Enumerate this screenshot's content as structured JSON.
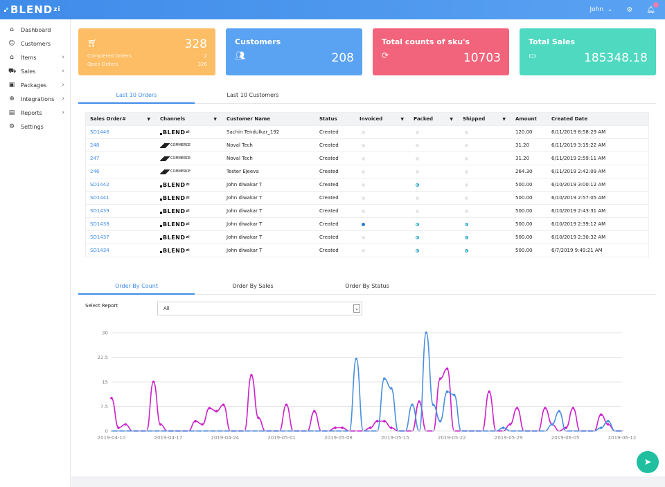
{
  "header": {
    "logo_text": "BLEND",
    "logo_suffix": "zi",
    "user": "John",
    "user_chevron": "⌄"
  },
  "sidebar": {
    "items": [
      {
        "label": "Dashboard",
        "icon": "home-icon",
        "chevron": false
      },
      {
        "label": "Customers",
        "icon": "user-icon",
        "chevron": false
      },
      {
        "label": "Items",
        "icon": "home-icon",
        "chevron": true
      },
      {
        "label": "Sales",
        "icon": "cart-icon",
        "chevron": true
      },
      {
        "label": "Packages",
        "icon": "package-icon",
        "chevron": true
      },
      {
        "label": "Integrations",
        "icon": "integration-icon",
        "chevron": true
      },
      {
        "label": "Reports",
        "icon": "report-icon",
        "chevron": true
      },
      {
        "label": "Settings",
        "icon": "gear-icon",
        "chevron": false
      }
    ]
  },
  "cards": {
    "orders": {
      "value": "328",
      "completed_label": "Completed Orders",
      "completed_value": "2",
      "open_label": "Open Orders",
      "open_value": "326"
    },
    "customers": {
      "title": "Customers",
      "value": "208"
    },
    "sku": {
      "title": "Total counts of sku's",
      "value": "10703"
    },
    "sales": {
      "title": "Total Sales",
      "value": "185348.18"
    }
  },
  "tabs_top": [
    "Last 10 Orders",
    "Last 10 Customers"
  ],
  "table": {
    "headers": [
      "Sales Order#",
      "Channels",
      "Customer Name",
      "Status",
      "Invoiced",
      "Packed",
      "Shipped",
      "Amount",
      "Created Date"
    ],
    "rows": [
      {
        "order": "SD1446",
        "channel": "blendzi",
        "customer": "Sachin Tendulkar_192",
        "status": "Created",
        "invoiced": "empty",
        "packed": "empty",
        "shipped": "empty",
        "amount": "120.00",
        "date": "6/11/2019 8:58:29 AM"
      },
      {
        "order": "248",
        "channel": "bigcommerce",
        "customer": "Noval Tech",
        "status": "Created",
        "invoiced": "empty",
        "packed": "empty",
        "shipped": "empty",
        "amount": "31.20",
        "date": "6/11/2019 3:15:22 AM"
      },
      {
        "order": "247",
        "channel": "bigcommerce",
        "customer": "Noval Tech",
        "status": "Created",
        "invoiced": "empty",
        "packed": "empty",
        "shipped": "empty",
        "amount": "31.20",
        "date": "6/11/2019 2:59:11 AM"
      },
      {
        "order": "246",
        "channel": "bigcommerce",
        "customer": "Tester Ejeeva",
        "status": "Created",
        "invoiced": "empty",
        "packed": "empty",
        "shipped": "empty",
        "amount": "264.30",
        "date": "6/11/2019 2:42:09 AM"
      },
      {
        "order": "SD1442",
        "channel": "blendzi",
        "customer": "John diwakar T",
        "status": "Created",
        "invoiced": "empty",
        "packed": "half",
        "shipped": "empty",
        "amount": "500.00",
        "date": "6/10/2019 3:00:12 AM"
      },
      {
        "order": "SD1441",
        "channel": "blendzi",
        "customer": "John diwakar T",
        "status": "Created",
        "invoiced": "empty",
        "packed": "empty",
        "shipped": "empty",
        "amount": "500.00",
        "date": "6/10/2019 2:57:05 AM"
      },
      {
        "order": "SD1439",
        "channel": "blendzi",
        "customer": "John diwakar T",
        "status": "Created",
        "invoiced": "empty",
        "packed": "empty",
        "shipped": "empty",
        "amount": "500.00",
        "date": "6/10/2019 2:43:31 AM"
      },
      {
        "order": "SD1438",
        "channel": "blendzi",
        "customer": "John diwakar T",
        "status": "Created",
        "invoiced": "full",
        "packed": "half",
        "shipped": "half",
        "amount": "500.00",
        "date": "6/10/2019 2:39:12 AM"
      },
      {
        "order": "SD1437",
        "channel": "blendzi",
        "customer": "John diwakar T",
        "status": "Created",
        "invoiced": "empty",
        "packed": "half",
        "shipped": "half",
        "amount": "500.00",
        "date": "6/10/2019 2:30:32 AM"
      },
      {
        "order": "SD1434",
        "channel": "blendzi",
        "customer": "John diwakar T",
        "status": "Created",
        "invoiced": "empty",
        "packed": "half",
        "shipped": "half",
        "amount": "500.00",
        "date": "6/7/2019 9:49:21 AM"
      }
    ],
    "channel_labels": {
      "blendzi": "BLEND",
      "blendzi_suffix": "zi",
      "bigcommerce": "COMMERCE"
    }
  },
  "tabs_chart": [
    "Order By Count",
    "Order By Sales",
    "Order By Status"
  ],
  "report": {
    "label": "Select Report",
    "selected": "All"
  },
  "chart_data": {
    "type": "line",
    "ylim": [
      0,
      30
    ],
    "yticks": [
      0,
      7.5,
      15,
      22.5,
      30
    ],
    "ytick_labels": [
      "0",
      "7.5",
      "15",
      "22.5",
      "30"
    ],
    "xtick_labels": [
      "2019-04-10",
      "2019-04-17",
      "2019-04-24",
      "2019-05-01",
      "2019-05-08",
      "2019-05-15",
      "2019-05-22",
      "2019-05-29",
      "2019-06-05",
      "2019-06-12"
    ],
    "x_start": "2019-04-10",
    "x_end": "2019-06-12",
    "series": [
      {
        "color": "#cc22cc",
        "values": [
          10,
          1,
          2,
          0,
          0,
          0,
          15,
          2,
          0,
          0,
          0,
          0,
          3,
          2,
          7,
          6,
          8,
          0,
          0,
          0,
          17,
          4,
          0,
          0,
          0,
          8,
          0,
          0,
          0,
          6,
          0,
          0,
          1,
          1,
          0,
          0,
          0,
          1,
          3,
          3,
          1,
          0,
          0,
          0,
          9,
          0,
          0,
          16,
          19,
          0,
          0,
          0,
          0,
          0,
          12,
          0,
          0,
          2,
          7,
          0,
          0,
          0,
          7,
          2,
          0,
          1,
          7,
          0,
          0,
          0,
          5,
          2,
          0,
          0
        ]
      },
      {
        "color": "#4a8fe0",
        "values": [
          0,
          0,
          0,
          0,
          0,
          0,
          0,
          0,
          0,
          0,
          0,
          0,
          0,
          0,
          0,
          0,
          0,
          0,
          0,
          0,
          0,
          0,
          0,
          0,
          0,
          0,
          0,
          0,
          0,
          0,
          0,
          0,
          0,
          0,
          0,
          22,
          0,
          0,
          0,
          16,
          13,
          0,
          0,
          8,
          0,
          30,
          8,
          3,
          12,
          11,
          0,
          0,
          0,
          0,
          0,
          0,
          1,
          0,
          0,
          0,
          0,
          0,
          0,
          2,
          6,
          0,
          0,
          0,
          0,
          0,
          1,
          3,
          0,
          0
        ]
      }
    ]
  },
  "colors": {
    "primary": "#3f8be9",
    "orange": "#fdbd64",
    "blue": "#5aa2f2",
    "red": "#f2647b",
    "teal": "#4fd9c0",
    "fab": "#1fbfa0"
  }
}
